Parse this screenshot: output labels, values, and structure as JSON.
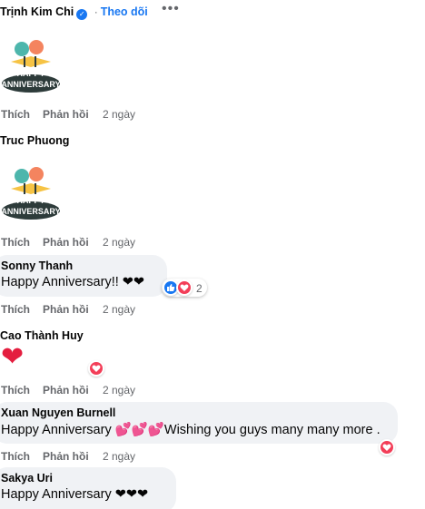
{
  "comments": [
    {
      "author": "Trịnh Kim Chi",
      "verified": true,
      "follow_label": "Theo dõi",
      "more_label": "•••",
      "sticker_text": "HAPPY ANNIVERSARY",
      "like": "Thích",
      "reply": "Phản hồi",
      "time": "2 ngày"
    },
    {
      "author": "Truc Phuong",
      "sticker_text": "HAPPY ANNIVERSARY",
      "like": "Thích",
      "reply": "Phản hồi",
      "time": "2 ngày"
    },
    {
      "author": "Sonny Thanh",
      "text": "Happy Anniversary!! ❤❤",
      "reaction_count": "2",
      "like": "Thích",
      "reply": "Phản hồi",
      "time": "2 ngày"
    },
    {
      "author": "Cao Thành Huy",
      "text": "❤",
      "like": "Thích",
      "reply": "Phản hồi",
      "time": "2 ngày"
    },
    {
      "author": "Xuan Nguyen Burnell",
      "text": "Happy Anniversary 💕💕💕Wishing you guys many many more .",
      "like": "Thích",
      "reply": "Phản hồi",
      "time": "2 ngày"
    },
    {
      "author": "Sakya Uri",
      "text": "Happy Anniversary ❤❤❤"
    }
  ],
  "icons": {
    "verified": "verified-badge-icon",
    "like_reaction": "like-reaction-icon",
    "love_reaction": "love-reaction-icon",
    "sticker": "birds-sticker-icon"
  },
  "colors": {
    "link_blue": "#1877f2",
    "love_red": "#f33e58",
    "bubble_bg": "#f0f2f5",
    "muted_text": "#65676b"
  }
}
